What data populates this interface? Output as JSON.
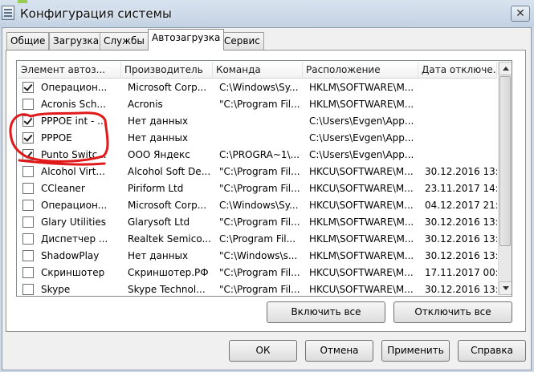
{
  "window": {
    "title": "Конфигурация системы",
    "close_label": "✕"
  },
  "tabs": [
    {
      "label": "Общие",
      "active": false
    },
    {
      "label": "Загрузка",
      "active": false
    },
    {
      "label": "Службы",
      "active": false
    },
    {
      "label": "Автозагрузка",
      "active": true
    },
    {
      "label": "Сервис",
      "active": false
    }
  ],
  "startup_list": {
    "columns": [
      "Элемент автоз...",
      "Производитель",
      "Команда",
      "Расположение",
      "Дата отключе..."
    ],
    "rows": [
      {
        "checked": true,
        "name": "Операцион...",
        "publisher": "Microsoft Corp...",
        "command": "C:\\Windows\\Sy...",
        "location": "HKLM\\SOFTWARE\\M...",
        "date": ""
      },
      {
        "checked": false,
        "name": "Acronis Sch...",
        "publisher": "Acronis",
        "command": "\"C:\\Program Fil...",
        "location": "HKLM\\SOFTWARE\\M...",
        "date": ""
      },
      {
        "checked": true,
        "name": "PPPOE int - ...",
        "publisher": "Нет данных",
        "command": "",
        "location": "C:\\Users\\Evgen\\App...",
        "date": ""
      },
      {
        "checked": true,
        "name": "PPPOE",
        "publisher": "Нет данных",
        "command": "",
        "location": "C:\\Users\\Evgen\\App...",
        "date": ""
      },
      {
        "checked": true,
        "name": "Punto Switc...",
        "publisher": "ООО Яндекс",
        "command": "C:\\PROGRA~1\\...",
        "location": "C:\\Users\\Evgen\\App...",
        "date": ""
      },
      {
        "checked": false,
        "name": "Alcohol Virt...",
        "publisher": "Alcohol Soft De...",
        "command": "\"C:\\Program Fil...",
        "location": "HKCU\\SOFTWARE\\M...",
        "date": "30.12.2016 13:..."
      },
      {
        "checked": false,
        "name": "CCleaner",
        "publisher": "Piriform Ltd",
        "command": "\"C:\\Program Fil...",
        "location": "HKCU\\SOFTWARE\\M...",
        "date": "23.11.2017 14:..."
      },
      {
        "checked": false,
        "name": "Операцион...",
        "publisher": "Microsoft Corp...",
        "command": "C:\\Windows\\Sy...",
        "location": "HKCU\\SOFTWARE\\M...",
        "date": "04.12.2017 21:..."
      },
      {
        "checked": false,
        "name": "Glary Utilities",
        "publisher": "Glarysoft Ltd",
        "command": "\"C:\\Program Fil...",
        "location": "HKLM\\SOFTWARE\\M...",
        "date": "30.12.2016 13:..."
      },
      {
        "checked": false,
        "name": "Диспетчер ...",
        "publisher": "Realtek Semico...",
        "command": "C:\\Program Fil...",
        "location": "HKLM\\SOFTWARE\\M...",
        "date": "30.12.2016 13:..."
      },
      {
        "checked": false,
        "name": "ShadowPlay",
        "publisher": "Нет данных",
        "command": "\"C:\\Windows\\s...",
        "location": "HKLM\\SOFTWARE\\M...",
        "date": "30.12.2016 13:..."
      },
      {
        "checked": false,
        "name": "Скриншотер",
        "publisher": "Скриншотер.РФ",
        "command": "\"C:\\Program Fil...",
        "location": "HKCU\\SOFTWARE\\M...",
        "date": "17.11.2017 00:..."
      },
      {
        "checked": false,
        "name": "Skype",
        "publisher": "Skype Technol...",
        "command": "\"C:\\Program Fil...",
        "location": "HKCU\\SOFTWARE\\M...",
        "date": "30.12.2016 13:..."
      }
    ]
  },
  "buttons": {
    "enable_all": "Включить все",
    "disable_all": "Отключить все",
    "ok": "ОК",
    "cancel": "Отмена",
    "apply": "Применить",
    "help": "Справка"
  },
  "annotation_color": "#e0191b",
  "icons": {
    "close": "close-icon",
    "app": "msconfig-icon",
    "scroll_up": "arrow-up-icon",
    "scroll_down": "arrow-down-icon"
  }
}
